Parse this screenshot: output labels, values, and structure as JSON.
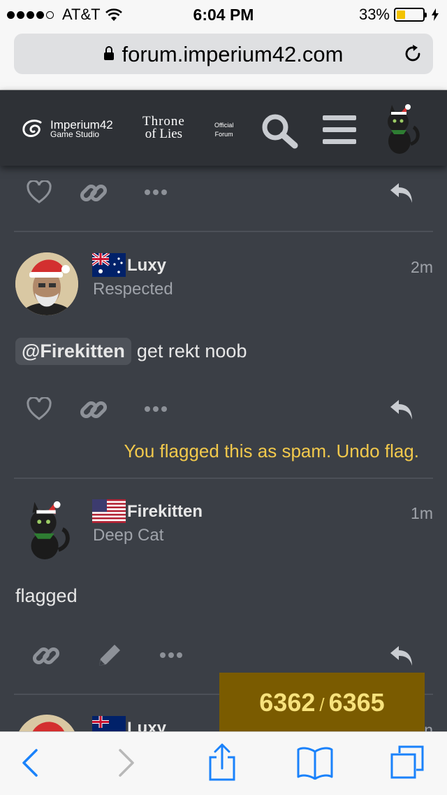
{
  "status_bar": {
    "carrier": "AT&T",
    "time": "6:04 PM",
    "battery_percent": "33%",
    "battery_level": 0.33,
    "signal_bars": 4,
    "signal_total": 5
  },
  "browser": {
    "url": "forum.imperium42.com"
  },
  "forum_header": {
    "brand_name": "Imperium42",
    "brand_sub": "Game Studio",
    "game_title_line1": "Throne",
    "game_title_line2": "of Lies",
    "official_line1": "Official",
    "official_line2": "Forum",
    "search_icon": "search-icon",
    "menu_icon": "hamburger-icon"
  },
  "posts": [
    {
      "username": "Luxy",
      "user_title": "Respected",
      "country_flag": "australia-flag",
      "time": "2m",
      "mention": "@Firekitten",
      "text": "get rekt noob",
      "flag_notice": "You flagged this as spam. Undo flag."
    },
    {
      "username": "Firekitten",
      "user_title": "Deep Cat",
      "country_flag": "usa-flag",
      "time": "1m",
      "text": "flagged"
    },
    {
      "username": "Luxy",
      "country_flag": "australia-flag",
      "time": "n"
    }
  ],
  "progress": {
    "current": "6362",
    "separator": "/",
    "total": "6365"
  },
  "colors": {
    "page_bg": "#3b3f46",
    "header_bg": "#2e3136",
    "notice": "#f2c94c",
    "progress_bg": "#7a5b00",
    "ios_blue": "#1a82fb"
  }
}
